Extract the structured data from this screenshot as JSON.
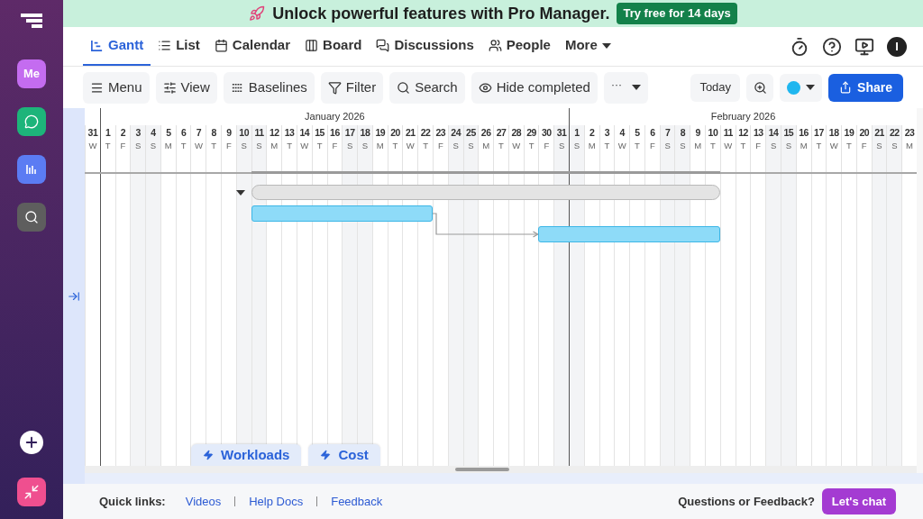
{
  "sidebar": {
    "items": [
      {
        "kind": "me",
        "label": "Me",
        "color": "#c46cf0"
      },
      {
        "kind": "chat",
        "color": "#1db47a"
      },
      {
        "kind": "reports",
        "color": "#5b7cf3"
      },
      {
        "kind": "search",
        "color": "#5e5e5e"
      }
    ]
  },
  "banner": {
    "text": "Unlock powerful features with Pro Manager.",
    "button": "Try free for 14 days"
  },
  "tabs": [
    {
      "label": "Gantt",
      "kind": "gantt",
      "selected": true
    },
    {
      "label": "List",
      "kind": "list",
      "selected": false
    },
    {
      "label": "Calendar",
      "kind": "calendar",
      "selected": false
    },
    {
      "label": "Board",
      "kind": "board",
      "selected": false
    },
    {
      "label": "Discussions",
      "kind": "discussions",
      "selected": false
    },
    {
      "label": "People",
      "kind": "people",
      "selected": false
    },
    {
      "label": "More",
      "kind": "more",
      "selected": false
    }
  ],
  "user_avatar": "I",
  "toolbar": [
    {
      "label": "Menu",
      "kind": "menu"
    },
    {
      "label": "View",
      "kind": "view"
    },
    {
      "label": "Baselines",
      "kind": "baselines"
    },
    {
      "label": "Filter",
      "kind": "filter"
    },
    {
      "label": "Search",
      "kind": "search"
    },
    {
      "label": "Hide completed",
      "kind": "hide"
    },
    {
      "label": "···",
      "kind": "overflow"
    }
  ],
  "toolbar_right": {
    "today": "Today",
    "color": "#1fb6ef",
    "share": "Share"
  },
  "timeline": {
    "months": [
      {
        "days": [
          {
            "day": "31",
            "weekday": "W",
            "weekend": false
          }
        ]
      },
      {
        "label": "January 2026",
        "days": [
          {
            "day": "1",
            "weekday": "T",
            "weekend": false
          },
          {
            "day": "2",
            "weekday": "F",
            "weekend": false
          },
          {
            "day": "3",
            "weekday": "S",
            "weekend": true
          },
          {
            "day": "4",
            "weekday": "S",
            "weekend": true
          },
          {
            "day": "5",
            "weekday": "M",
            "weekend": false
          },
          {
            "day": "6",
            "weekday": "T",
            "weekend": false
          },
          {
            "day": "7",
            "weekday": "W",
            "weekend": false
          },
          {
            "day": "8",
            "weekday": "T",
            "weekend": false
          },
          {
            "day": "9",
            "weekday": "F",
            "weekend": false
          },
          {
            "day": "10",
            "weekday": "S",
            "weekend": true
          },
          {
            "day": "11",
            "weekday": "S",
            "weekend": true
          },
          {
            "day": "12",
            "weekday": "M",
            "weekend": false
          },
          {
            "day": "13",
            "weekday": "T",
            "weekend": false
          },
          {
            "day": "14",
            "weekday": "W",
            "weekend": false
          },
          {
            "day": "15",
            "weekday": "T",
            "weekend": false
          },
          {
            "day": "16",
            "weekday": "F",
            "weekend": false
          },
          {
            "day": "17",
            "weekday": "S",
            "weekend": true
          },
          {
            "day": "18",
            "weekday": "S",
            "weekend": true
          },
          {
            "day": "19",
            "weekday": "M",
            "weekend": false
          },
          {
            "day": "20",
            "weekday": "T",
            "weekend": false
          },
          {
            "day": "21",
            "weekday": "W",
            "weekend": false
          },
          {
            "day": "22",
            "weekday": "T",
            "weekend": false
          },
          {
            "day": "23",
            "weekday": "F",
            "weekend": false
          },
          {
            "day": "24",
            "weekday": "S",
            "weekend": true
          },
          {
            "day": "25",
            "weekday": "S",
            "weekend": true
          },
          {
            "day": "26",
            "weekday": "M",
            "weekend": false
          },
          {
            "day": "27",
            "weekday": "T",
            "weekend": false
          },
          {
            "day": "28",
            "weekday": "W",
            "weekend": false
          },
          {
            "day": "29",
            "weekday": "T",
            "weekend": false
          },
          {
            "day": "30",
            "weekday": "F",
            "weekend": false
          },
          {
            "day": "31",
            "weekday": "S",
            "weekend": true
          }
        ]
      },
      {
        "label": "February 2026",
        "days": [
          {
            "day": "1",
            "weekday": "S",
            "weekend": true
          },
          {
            "day": "2",
            "weekday": "M",
            "weekend": false
          },
          {
            "day": "3",
            "weekday": "T",
            "weekend": false
          },
          {
            "day": "4",
            "weekday": "W",
            "weekend": false
          },
          {
            "day": "5",
            "weekday": "T",
            "weekend": false
          },
          {
            "day": "6",
            "weekday": "F",
            "weekend": false
          },
          {
            "day": "7",
            "weekday": "S",
            "weekend": true
          },
          {
            "day": "8",
            "weekday": "S",
            "weekend": true
          },
          {
            "day": "9",
            "weekday": "M",
            "weekend": false
          },
          {
            "day": "10",
            "weekday": "T",
            "weekend": false
          },
          {
            "day": "11",
            "weekday": "W",
            "weekend": false
          },
          {
            "day": "12",
            "weekday": "T",
            "weekend": false
          },
          {
            "day": "13",
            "weekday": "F",
            "weekend": false
          },
          {
            "day": "14",
            "weekday": "S",
            "weekend": true
          },
          {
            "day": "15",
            "weekday": "S",
            "weekend": true
          },
          {
            "day": "16",
            "weekday": "M",
            "weekend": false
          },
          {
            "day": "17",
            "weekday": "T",
            "weekend": false
          },
          {
            "day": "18",
            "weekday": "W",
            "weekend": false
          },
          {
            "day": "19",
            "weekday": "T",
            "weekend": false
          },
          {
            "day": "20",
            "weekday": "F",
            "weekend": false
          },
          {
            "day": "21",
            "weekday": "S",
            "weekend": true
          },
          {
            "day": "22",
            "weekday": "S",
            "weekend": true
          },
          {
            "day": "23",
            "weekday": "M",
            "weekend": false
          }
        ]
      }
    ]
  },
  "tasks": [
    {
      "kind": "summary",
      "expanded": true
    },
    {
      "kind": "task",
      "linked_to_next": true
    },
    {
      "kind": "task"
    }
  ],
  "bottom_tabs": [
    {
      "label": "Workloads"
    },
    {
      "label": "Cost"
    }
  ],
  "footer": {
    "quick_links_label": "Quick links:",
    "links": [
      "Videos",
      "Help Docs",
      "Feedback"
    ],
    "question": "Questions or Feedback?",
    "chat_button": "Let's chat"
  }
}
